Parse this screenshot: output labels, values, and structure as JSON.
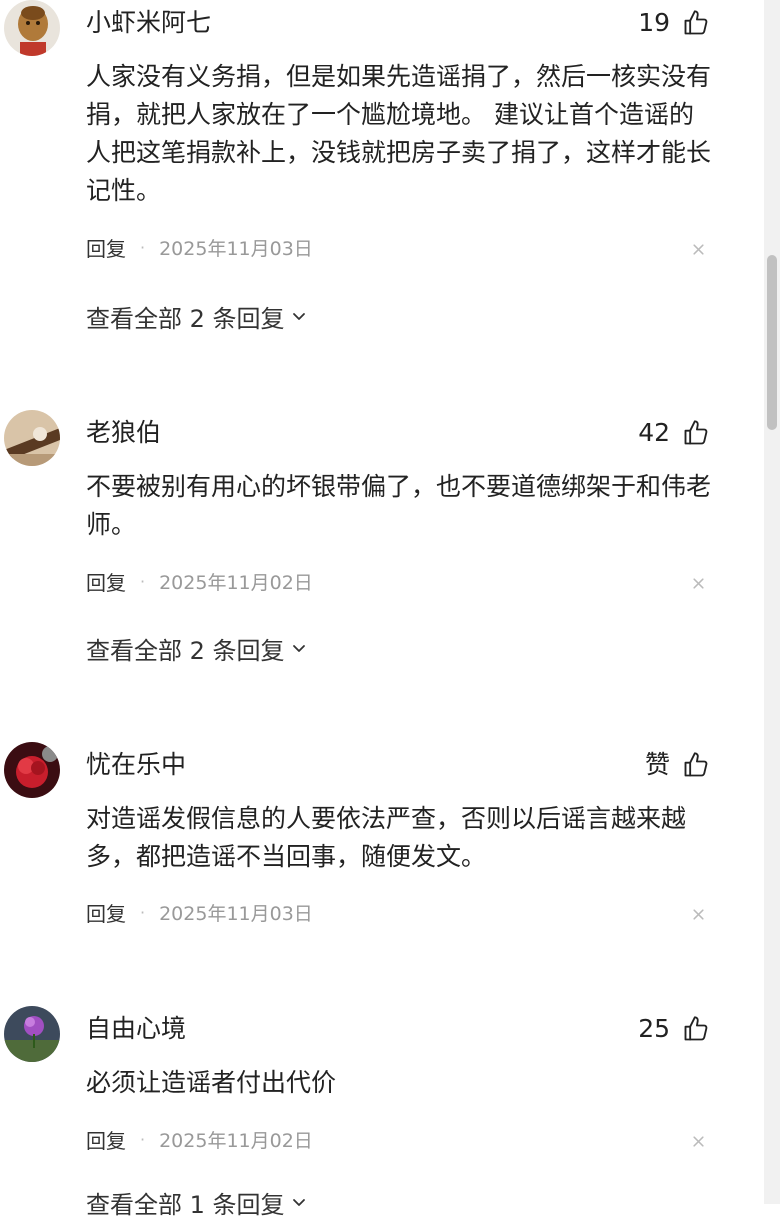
{
  "comments": [
    {
      "username": "小虾米阿七",
      "likes": "19",
      "text": "人家没有义务捐，但是如果先造谣捐了，然后一核实没有捐，就把人家放在了一个尴尬境地。 建议让首个造谣的人把这笔捐款补上，没钱就把房子卖了捐了，这样才能长记性。",
      "reply_label": "回复",
      "separator": "·",
      "date": "2025年11月03日",
      "view_replies": "查看全部 2 条回复",
      "avatar_icon": "cartoon-face-avatar"
    },
    {
      "username": "老狼伯",
      "likes": "42",
      "text": "不要被别有用心的坏银带偏了，也不要道德绑架于和伟老师。",
      "reply_label": "回复",
      "separator": "·",
      "date": "2025年11月02日",
      "view_replies": "查看全部 2 条回复",
      "avatar_icon": "hat-photo-avatar"
    },
    {
      "username": "忧在乐中",
      "likes": "赞",
      "text": "对造谣发假信息的人要依法严查，否则以后谣言越来越多，都把造谣不当回事，随便发文。",
      "reply_label": "回复",
      "separator": "·",
      "date": "2025年11月03日",
      "avatar_icon": "red-flower-avatar"
    },
    {
      "username": "自由心境",
      "likes": "25",
      "text": "必须让造谣者付出代价",
      "reply_label": "回复",
      "separator": "·",
      "date": "2025年11月02日",
      "view_replies": "查看全部 1 条回复",
      "avatar_icon": "purple-flower-avatar"
    }
  ],
  "colors": {
    "text": "#222222",
    "meta_text": "#999999",
    "scrollbar_thumb": "#c1c1c1"
  }
}
